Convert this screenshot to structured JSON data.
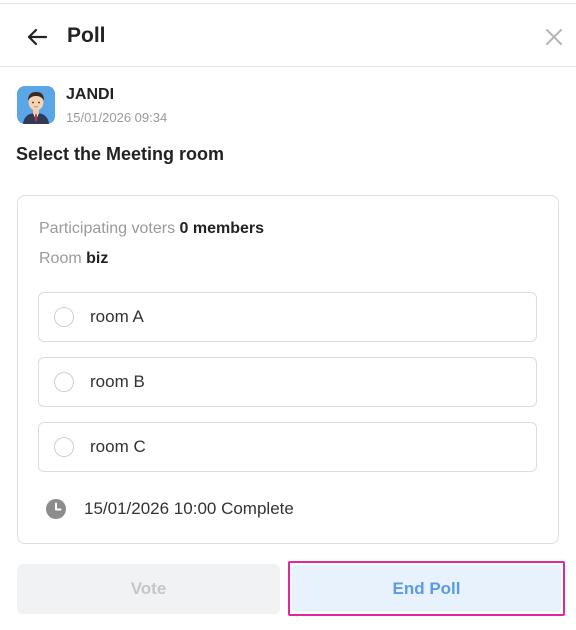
{
  "header": {
    "title": "Poll"
  },
  "author": {
    "name": "JANDI",
    "timestamp": "15/01/2026 09:34"
  },
  "poll": {
    "question": "Select the Meeting room",
    "voters_label": "Participating voters",
    "voters_value": "0 members",
    "room_label": "Room",
    "room_value": "biz",
    "options": [
      {
        "label": "room A",
        "selected": false
      },
      {
        "label": "room B",
        "selected": false
      },
      {
        "label": "room C",
        "selected": false
      }
    ],
    "deadline": "15/01/2026 10:00 Complete"
  },
  "actions": {
    "vote_label": "Vote",
    "end_poll_label": "End Poll"
  },
  "colors": {
    "highlight": "#e4269a",
    "end_poll_text": "#5c9be4",
    "end_poll_bg": "#e8f2fc",
    "vote_disabled_text": "#c4c6ca"
  }
}
